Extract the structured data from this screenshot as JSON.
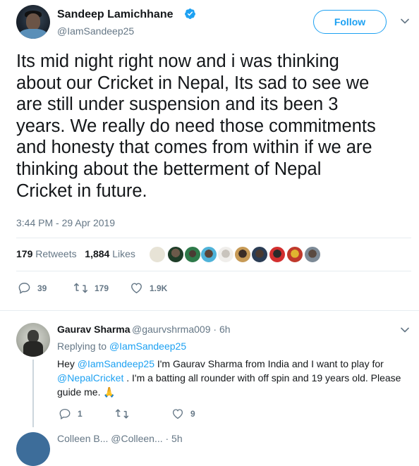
{
  "tweet": {
    "author": {
      "name": "Sandeep Lamichhane",
      "handle": "@IamSandeep25",
      "verified": true,
      "avatar_icon": "profile-photo-icon"
    },
    "follow_label": "Follow",
    "text": "Its mid night right now and i was thinking\nabout our Cricket in Nepal, Its sad to see we\nare still under suspension and its been 3\nyears. We really do need those commitments\nand honesty that comes from within if we are\nthinking about the betterment of Nepal\nCricket in future.",
    "timestamp": "3:44 PM - 29 Apr 2019",
    "stats": {
      "retweets_count": "179",
      "retweets_label": "Retweets",
      "likes_count": "1,884",
      "likes_label": "Likes"
    },
    "liked_by_avatar_count": 10,
    "actions": {
      "replies": "39",
      "retweets": "179",
      "likes": "1.9K"
    }
  },
  "reply": {
    "author": {
      "name": "Gaurav Sharma",
      "handle": "@gaurvshrma009",
      "time": "· 6h"
    },
    "replying_to_label": "Replying to",
    "replying_to_handle": "@IamSandeep25",
    "text": {
      "part1": "Hey ",
      "mention1": "@IamSandeep25",
      "part2": " I'm Gaurav Sharma from India and I want to play for ",
      "mention2": "@NepalCricket",
      "part3": " . I'm a batting all rounder with off spin and 19 years old. Please guide me. ",
      "emoji": "🙏"
    },
    "actions": {
      "replies": "1",
      "retweets": "",
      "likes": "9"
    }
  },
  "next_reply": {
    "preview": "Colleen B... @Colleen... · 5h"
  },
  "colors": {
    "accent": "#1da1f2",
    "text": "#14171a",
    "muted": "#657786",
    "divider": "#e6ecf0"
  }
}
